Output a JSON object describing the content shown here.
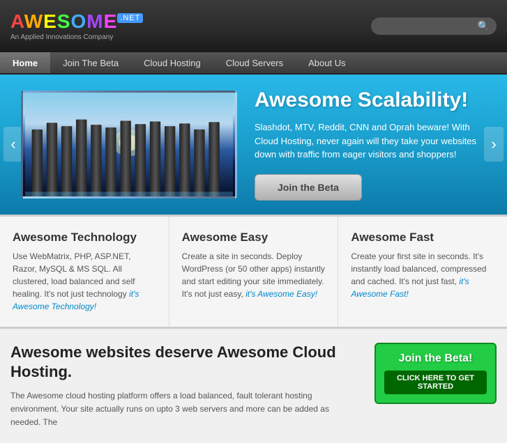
{
  "header": {
    "logo": "AWESOME",
    "logo_net": ".NET",
    "tagline": "An Applied Innovations Company",
    "search_placeholder": ""
  },
  "nav": {
    "items": [
      {
        "label": "Home",
        "active": true
      },
      {
        "label": "Join The Beta",
        "active": false
      },
      {
        "label": "Cloud Hosting",
        "active": false
      },
      {
        "label": "Cloud Servers",
        "active": false
      },
      {
        "label": "About Us",
        "active": false
      }
    ]
  },
  "hero": {
    "title": "Awesome Scalability!",
    "description": "Slashdot, MTV, Reddit, CNN and Oprah beware! With Cloud Hosting, never again will they take your websites down with traffic from eager visitors and shoppers!",
    "cta_label": "Join the Beta"
  },
  "features": [
    {
      "title": "Awesome Technology",
      "text": "Use WebMatrix, PHP, ASP.NET, Razor, MySQL & MS SQL. All clustered, load balanced and self healing. It's not just technology ",
      "link_text": "it's Awesome Technology!"
    },
    {
      "title": "Awesome Easy",
      "text": "Create a site in seconds. Deploy WordPress (or 50 other apps) instantly and start editing your site immediately. It's not just easy, ",
      "link_text": "it's Awesome Easy!"
    },
    {
      "title": "Awesome Fast",
      "text": "Create your first site in seconds. It's instantly load balanced, compressed and cached. It's not just fast, ",
      "link_text": "it's Awesome Fast!"
    }
  ],
  "bottom": {
    "title": "Awesome websites deserve Awesome Cloud Hosting.",
    "description": "The Awesome cloud hosting platform offers a load balanced, fault tolerant hosting environment. Your site actually runs on upto 3 web servers and more can be added as needed. The",
    "cta_title": "Join the Beta!",
    "cta_sub": "CLICK HERE TO GET STARTED"
  }
}
